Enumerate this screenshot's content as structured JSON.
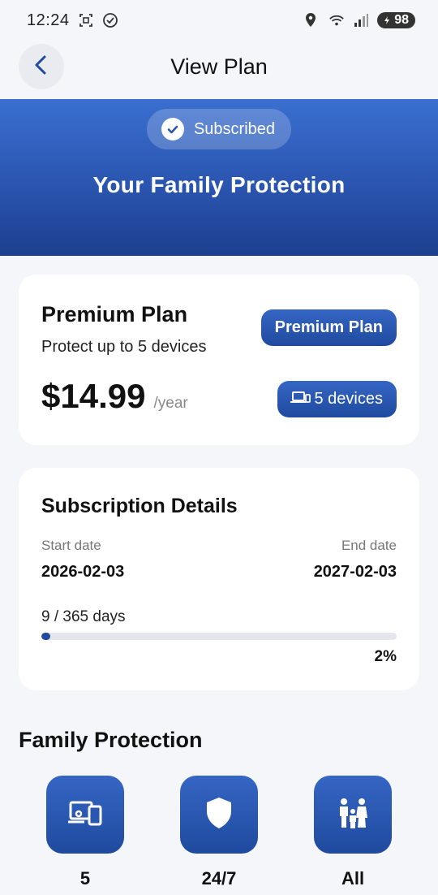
{
  "status_bar": {
    "time": "12:24",
    "battery": "98",
    "icons": [
      "screenshot-icon",
      "check-circle-icon",
      "location-icon",
      "wifi-icon",
      "signal-icon",
      "battery-icon"
    ]
  },
  "header": {
    "title": "View Plan",
    "back_icon": "chevron-left-icon"
  },
  "hero": {
    "badge_label": "Subscribed",
    "title": "Your Family Protection"
  },
  "plan": {
    "name": "Premium Plan",
    "description": "Protect up to 5 devices",
    "badge_label": "Premium Plan",
    "price": "$14.99",
    "period": "/year",
    "devices_label": "5 devices"
  },
  "subscription": {
    "title": "Subscription Details",
    "start_label": "Start date",
    "start_value": "2026-02-03",
    "end_label": "End date",
    "end_value": "2027-02-03",
    "days_text": "9 / 365 days",
    "progress_fraction": 0.02,
    "progress_percent": "2%"
  },
  "family": {
    "title": "Family Protection",
    "features": [
      {
        "icon": "devices-icon",
        "value": "5"
      },
      {
        "icon": "shield-icon",
        "value": "24/7"
      },
      {
        "icon": "family-icon",
        "value": "All"
      }
    ]
  },
  "colors": {
    "accent": "#1f4a9e",
    "hero_top": "#3a6fd0",
    "hero_bottom": "#1d3f8f",
    "background": "#f5f6fa"
  }
}
